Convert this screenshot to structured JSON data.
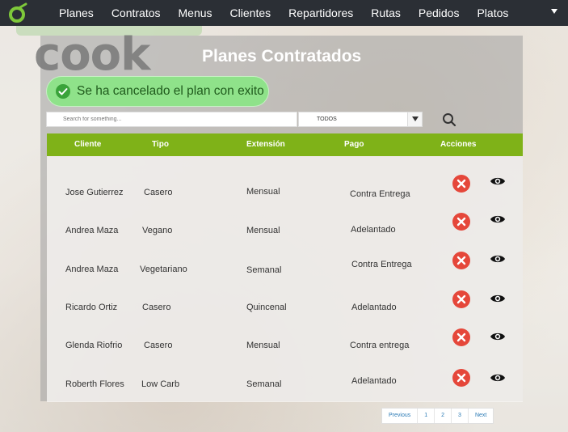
{
  "nav": {
    "items": [
      "Planes",
      "Contratos",
      "Menus",
      "Clientes",
      "Repartidores",
      "Rutas",
      "Pedidos",
      "Platos"
    ]
  },
  "logo": {
    "text": "cook"
  },
  "page": {
    "title": "Planes Contratados"
  },
  "toast": {
    "message": "Se ha cancelado el plan con exito"
  },
  "filters": {
    "search_placeholder": "Search for something...",
    "select_value": "TODOS"
  },
  "table": {
    "headers": [
      "Cliente",
      "Tipo",
      "Extensión",
      "Pago",
      "Acciones"
    ],
    "rows": [
      {
        "cliente": "Jose Gutierrez",
        "tipo": "Casero",
        "extension": "Mensual",
        "pago": "Contra Entrega"
      },
      {
        "cliente": "Andrea Maza",
        "tipo": "Vegano",
        "extension": "Mensual",
        "pago": "Adelantado"
      },
      {
        "cliente": "Andrea Maza",
        "tipo": "Vegetariano",
        "extension": "Semanal",
        "pago": "Contra Entrega"
      },
      {
        "cliente": "Ricardo Ortiz",
        "tipo": "Casero",
        "extension": "Quincenal",
        "pago": "Adelantado"
      },
      {
        "cliente": "Glenda Riofrio",
        "tipo": "Casero",
        "extension": "Mensual",
        "pago": "Contra entrega"
      },
      {
        "cliente": "Roberth Flores",
        "tipo": "Low Carb",
        "extension": "Semanal",
        "pago": "Adelantado"
      }
    ]
  },
  "pagination": {
    "previous": "Previous",
    "pages": [
      "1",
      "2",
      "3"
    ],
    "next": "Next"
  },
  "colors": {
    "accent_green": "#7fb218",
    "toast_green": "#8fe28a",
    "cancel_red": "#e5473a",
    "nav_bg": "#2b2f35"
  },
  "icons": {
    "brand": "brand-logo-icon",
    "toast": "check-circle-icon",
    "search": "search-icon",
    "cancel": "close-circle-icon",
    "view": "eye-icon",
    "dropdown": "chevron-down-icon"
  }
}
